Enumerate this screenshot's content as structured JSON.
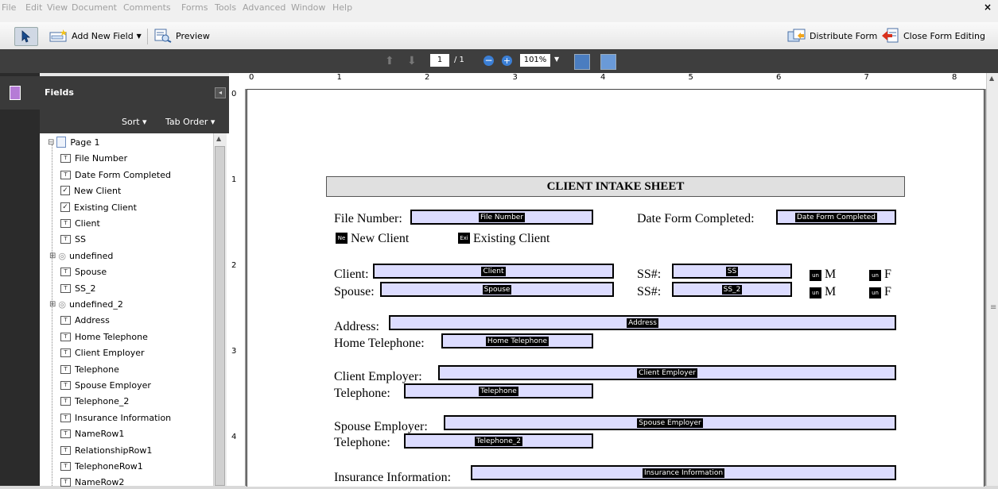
{
  "menu": [
    "File",
    "Edit",
    "View",
    "Document",
    "Comments",
    "Forms",
    "Tools",
    "Advanced",
    "Window",
    "Help"
  ],
  "window": {
    "close": "×"
  },
  "toolbar": {
    "add_new_field": "Add New Field",
    "preview": "Preview",
    "distribute_form": "Distribute Form",
    "close_form_editing": "Close Form Editing"
  },
  "nav": {
    "page_current": "1",
    "page_total": "/ 1",
    "zoom": "101%"
  },
  "fields_panel": {
    "title": "Fields",
    "sort": "Sort ▾",
    "tab_order": "Tab Order ▾",
    "items": [
      {
        "label": "Page 1",
        "type": "page"
      },
      {
        "label": "File Number",
        "type": "text"
      },
      {
        "label": "Date Form Completed",
        "type": "text"
      },
      {
        "label": "New Client",
        "type": "check"
      },
      {
        "label": "Existing Client",
        "type": "check"
      },
      {
        "label": "Client",
        "type": "text"
      },
      {
        "label": "SS",
        "type": "text"
      },
      {
        "label": "undefined",
        "type": "group"
      },
      {
        "label": "Spouse",
        "type": "text"
      },
      {
        "label": "SS_2",
        "type": "text"
      },
      {
        "label": "undefined_2",
        "type": "group"
      },
      {
        "label": "Address",
        "type": "text"
      },
      {
        "label": "Home Telephone",
        "type": "text"
      },
      {
        "label": "Client Employer",
        "type": "text"
      },
      {
        "label": "Telephone",
        "type": "text"
      },
      {
        "label": "Spouse Employer",
        "type": "text"
      },
      {
        "label": "Telephone_2",
        "type": "text"
      },
      {
        "label": "Insurance Information",
        "type": "text"
      },
      {
        "label": "NameRow1",
        "type": "text"
      },
      {
        "label": "RelationshipRow1",
        "type": "text"
      },
      {
        "label": "TelephoneRow1",
        "type": "text"
      },
      {
        "label": "NameRow2",
        "type": "text"
      }
    ]
  },
  "ruler": {
    "h": [
      "0",
      "1",
      "2",
      "3",
      "4",
      "5",
      "6",
      "7",
      "8"
    ],
    "v": [
      "0",
      "1",
      "2",
      "3",
      "4"
    ]
  },
  "form": {
    "title": "CLIENT INTAKE SHEET",
    "labels": {
      "file_number": "File Number:",
      "date_completed": "Date Form Completed:",
      "new_client": "New Client",
      "existing_client": "Existing Client",
      "client": "Client:",
      "spouse": "Spouse:",
      "ss1": "SS#:",
      "ss2": "SS#:",
      "m1": "M",
      "f1": "F",
      "m2": "M",
      "f2": "F",
      "address": "Address:",
      "home_telephone": "Home Telephone:",
      "client_employer": "Client Employer:",
      "telephone": "Telephone:",
      "spouse_employer": "Spouse Employer:",
      "telephone2": "Telephone:",
      "insurance": "Insurance Information:"
    },
    "fields": {
      "file_number": "File Number",
      "date_completed": "Date Form Completed",
      "client": "Client",
      "ss": "SS",
      "spouse": "Spouse",
      "ss2": "SS_2",
      "address": "Address",
      "home_telephone": "Home Telephone",
      "client_employer": "Client Employer",
      "telephone": "Telephone",
      "spouse_employer": "Spouse Employer",
      "telephone2": "Telephone_2",
      "insurance": "Insurance Information"
    },
    "checkbox_tags": {
      "new_client": "Ne",
      "existing_client": "Exi",
      "m": "un",
      "f": "un"
    }
  }
}
